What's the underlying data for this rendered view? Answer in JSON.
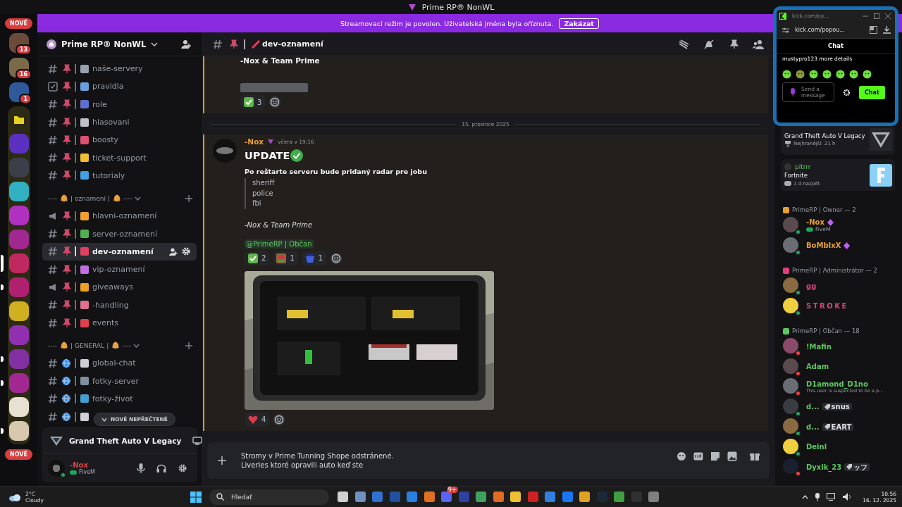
{
  "window": {
    "title": "Prime RP® NonWL"
  },
  "banner": {
    "text": "Streamovací režim je povolen. Uživatelská jména byla oříznuta.",
    "button": "Zakázat"
  },
  "server_rail": {
    "top_badge": "NOVÉ",
    "bottom_badge": "NOVÉ",
    "servers": [
      {
        "kind": "server",
        "color": "#6b4a3a",
        "badge": "13",
        "unread": false,
        "selected": false
      },
      {
        "kind": "server",
        "color": "#7a6a4a",
        "badge": "16",
        "unread": false,
        "selected": false
      },
      {
        "kind": "server",
        "color": "#2f5a9a",
        "badge": "1",
        "unread": false,
        "selected": false
      },
      {
        "kind": "folder",
        "color": "#e8d020",
        "children": [
          {
            "kind": "server",
            "color": "#5b2fc0",
            "unread": false,
            "selected": false
          },
          {
            "kind": "server",
            "color": "#3a3f4a",
            "unread": false,
            "selected": false
          },
          {
            "kind": "server",
            "color": "#30b0c0",
            "unread": false,
            "selected": false
          },
          {
            "kind": "server",
            "color": "#b030c0",
            "unread": false,
            "selected": false
          },
          {
            "kind": "server",
            "color": "#a02890",
            "unread": false,
            "selected": false
          },
          {
            "kind": "server",
            "color": "#c02860",
            "unread": false,
            "selected": true
          },
          {
            "kind": "server",
            "color": "#b02070",
            "unread": true,
            "selected": false
          },
          {
            "kind": "server",
            "color": "#d0b020",
            "unread": false,
            "selected": false
          },
          {
            "kind": "server",
            "color": "#9030b0",
            "unread": false,
            "selected": false
          },
          {
            "kind": "server",
            "color": "#8030a0",
            "unread": true,
            "selected": false
          },
          {
            "kind": "server",
            "color": "#a02890",
            "unread": true,
            "selected": false
          },
          {
            "kind": "server",
            "color": "#e8e0d0",
            "unread": false,
            "selected": false
          },
          {
            "kind": "server",
            "color": "#d8c8b0",
            "unread": true,
            "selected": false
          }
        ]
      }
    ]
  },
  "sidebar": {
    "server_name": "Prime RP® NonWL",
    "channels": [
      {
        "kind": "text",
        "pinned": true,
        "color": "#9aa0b0",
        "name": "naše-servery",
        "selected": false
      },
      {
        "kind": "rules",
        "pinned": true,
        "color": "#6aa0e0",
        "name": "pravidla",
        "selected": false
      },
      {
        "kind": "text",
        "pinned": true,
        "color": "#6070d0",
        "name": "role",
        "selected": false
      },
      {
        "kind": "text",
        "pinned": true,
        "color": "#c0c0c8",
        "name": "hlasovani",
        "selected": false
      },
      {
        "kind": "text",
        "pinned": true,
        "color": "#e05070",
        "name": "boosty",
        "selected": false
      },
      {
        "kind": "text",
        "pinned": true,
        "color": "#f0c030",
        "name": "ticket-support",
        "selected": false
      },
      {
        "kind": "text",
        "pinned": true,
        "color": "#40a0e0",
        "name": "tutorialy",
        "selected": false
      },
      {
        "kind": "category",
        "label": "oznamení",
        "edge": "----",
        "divider": "|",
        "expanded": true
      },
      {
        "kind": "announce",
        "pinned": true,
        "color": "#f0a030",
        "name": "hlavni-oznamení",
        "selected": false
      },
      {
        "kind": "text",
        "pinned": true,
        "color": "#50b050",
        "name": "server-oznamení",
        "selected": false
      },
      {
        "kind": "text",
        "pinned": true,
        "color": "#e04060",
        "name": "dev-oznamení",
        "selected": true
      },
      {
        "kind": "text",
        "pinned": true,
        "color": "#c070e0",
        "name": "vip-oznamení",
        "selected": false
      },
      {
        "kind": "announce",
        "pinned": true,
        "color": "#f0a020",
        "name": "giveaways",
        "selected": false
      },
      {
        "kind": "text",
        "pinned": true,
        "color": "#e07090",
        "name": "-handling",
        "selected": false
      },
      {
        "kind": "text",
        "pinned": true,
        "color": "#e04050",
        "name": "events",
        "selected": false
      },
      {
        "kind": "category",
        "label": "GENERAL",
        "edge": "----",
        "divider": "|",
        "expanded": true
      },
      {
        "kind": "text",
        "pinned": false,
        "color": "#d0d0d8",
        "name": "global-chat",
        "selected": false
      },
      {
        "kind": "text",
        "pinned": false,
        "color": "#8090a0",
        "name": "fotky-server",
        "selected": false
      },
      {
        "kind": "text",
        "pinned": false,
        "color": "#40a0d0",
        "name": "fotky-život",
        "selected": false
      },
      {
        "kind": "text",
        "pinned": false,
        "color": "#d0d0d8",
        "selected": false
      }
    ],
    "unread_pill": "NOVÉ NEPŘEČTENÉ",
    "activity": {
      "game": "Grand Theft Auto V Legacy"
    },
    "user": {
      "name": "-Nox",
      "activity": "FiveM",
      "dnd": false
    }
  },
  "chat": {
    "channel": "dev-oznamení",
    "previous": {
      "signature": "-Nox & Team Prime",
      "reactions": [
        {
          "kind": "check",
          "count": "3"
        }
      ]
    },
    "date_divider": "15. prosince 2025",
    "message": {
      "author": "-Nox",
      "time": "včera v 19:16",
      "heading": "UPDATE",
      "lead": "Po reštarte serveru bude pridaný radar pre jobu",
      "quote": [
        "sheriff",
        "police",
        "fbi"
      ],
      "signature": "-Nox & Team Prime",
      "mention": "@PrimeRP | Občan",
      "reactions": [
        {
          "kind": "check",
          "count": "2"
        },
        {
          "kind": "picture",
          "count": "1"
        },
        {
          "kind": "blue",
          "count": "1"
        }
      ],
      "attachment": {
        "kind": "picture"
      },
      "attachment_reactions": [
        {
          "kind": "heart",
          "count": "4"
        }
      ]
    },
    "composer": {
      "lines": [
        "Stromy v Prime Tunning Shope odstránené.",
        "Liveries ktoré opravili auto keď ste"
      ]
    }
  },
  "members": {
    "activity_cards": [
      {
        "kind": "gta",
        "game": "Grand Theft Auto V Legacy",
        "detail": "Nejhranější: 21 h"
      },
      {
        "kind": "fortnite",
        "user": "pitrrr",
        "game": "Fortnite",
        "detail": "1 d nazpět"
      }
    ],
    "groups": [
      {
        "title": "PrimeRP | Owner — 2",
        "color": "#e8a030",
        "members": [
          {
            "name": "-Nox",
            "activity": "FiveM",
            "dnd": false,
            "boost": true
          },
          {
            "name": "BoMbIxX",
            "dnd": false,
            "boost": true
          }
        ]
      },
      {
        "title": "PrimeRP | Administrátor — 2",
        "color": "#e0407a",
        "members": [
          {
            "name": "gg",
            "dnd": false,
            "boost": false
          },
          {
            "name": "STROKE",
            "dnd": false,
            "boost": false
          }
        ]
      },
      {
        "title": "PrimeRP | Občan — 18",
        "color": "#5cc860",
        "members": [
          {
            "name": "!Mafin",
            "dnd": true,
            "boost": false
          },
          {
            "name": "Adam",
            "dnd": true,
            "boost": false
          },
          {
            "name": "D1amond_D1no",
            "note": "This user is suspected to be a p...",
            "dnd": true,
            "boost": false
          },
          {
            "name": "d...",
            "tag": "snus",
            "dnd": false,
            "boost": false
          },
          {
            "name": "d...",
            "tag": "EART",
            "dnd": false,
            "boost": false
          },
          {
            "name": "Deinl",
            "dnd": false,
            "boost": false
          },
          {
            "name": "Dyxik_23",
            "tag": "ッフ",
            "dnd": true,
            "boost": false
          }
        ]
      }
    ]
  },
  "kick_popup": {
    "tab_title": "kick.com/po...",
    "url": "kick.com/popou...",
    "heading": "Chat",
    "message": "mustypro123 more details",
    "placeholder": "Send a message",
    "button": "Chat"
  },
  "taskbar": {
    "weather": {
      "temp": "2°C",
      "desc": "Cloudy"
    },
    "search": "Hledať",
    "apps": [
      {
        "color": "#d0d0d0"
      },
      {
        "color": "#7090c0"
      },
      {
        "color": "#3070d0"
      },
      {
        "color": "#2050a0"
      },
      {
        "color": "#2a80e0"
      },
      {
        "color": "#e07020"
      },
      {
        "color": "#5865f2",
        "badge": "9+"
      },
      {
        "color": "#3040a0"
      },
      {
        "color": "#40a060"
      },
      {
        "color": "#e06a20"
      },
      {
        "color": "#f0c030"
      },
      {
        "color": "#d02020"
      },
      {
        "color": "#3080e0"
      },
      {
        "color": "#1877f2"
      },
      {
        "color": "#e0a020"
      },
      {
        "color": "#1b2838"
      },
      {
        "color": "#40a040"
      },
      {
        "color": "#303030"
      },
      {
        "color": "#808080"
      }
    ],
    "time": "10:56",
    "date": "16. 12. 2025"
  }
}
